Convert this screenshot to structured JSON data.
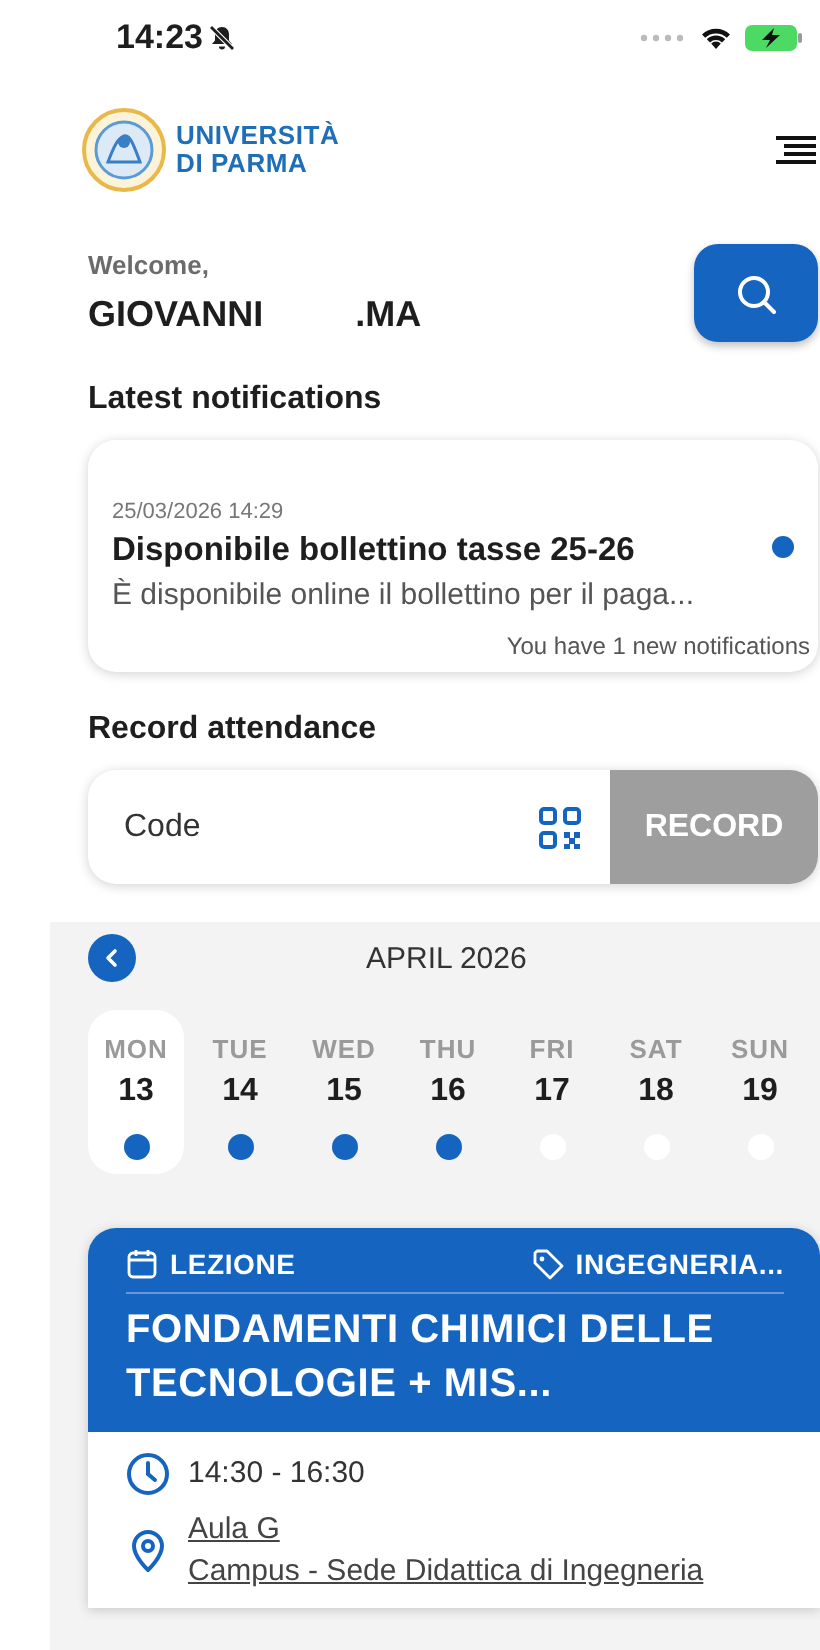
{
  "status_bar": {
    "time": "14:23",
    "muted": true
  },
  "header": {
    "logo_line_1": "UNIVERSITÀ",
    "logo_line_2": "DI PARMA"
  },
  "greeting": {
    "label": "Welcome,",
    "name_first": "GIOVANNI",
    "name_last": ".MA"
  },
  "notifications": {
    "title": "Latest notifications",
    "items": [
      {
        "date": "25/03/2026 14:29",
        "title": "Disponibile bollettino tasse 25-26",
        "body": "È disponibile online il bollettino per il paga...",
        "unread": true
      }
    ],
    "footer": "You have 1 new notifications"
  },
  "attendance": {
    "title": "Record attendance",
    "placeholder": "Code",
    "button": "RECORD",
    "button_disabled": true
  },
  "calendar": {
    "month": "APRIL 2026",
    "days": [
      {
        "weekday": "MON",
        "day": "13",
        "selected": true,
        "has_events": true
      },
      {
        "weekday": "TUE",
        "day": "14",
        "selected": false,
        "has_events": true
      },
      {
        "weekday": "WED",
        "day": "15",
        "selected": false,
        "has_events": true
      },
      {
        "weekday": "THU",
        "day": "16",
        "selected": false,
        "has_events": true
      },
      {
        "weekday": "FRI",
        "day": "17",
        "selected": false,
        "has_events": false
      },
      {
        "weekday": "SAT",
        "day": "18",
        "selected": false,
        "has_events": false
      },
      {
        "weekday": "SUN",
        "day": "19",
        "selected": false,
        "has_events": false
      }
    ]
  },
  "events": [
    {
      "type": "LEZIONE",
      "tag": "INGEGNERIA...",
      "title": "FONDAMENTI CHIMICI DELLE TECNOLOGIE + MIS...",
      "time": "14:30 - 16:30",
      "room": "Aula G",
      "building": "Campus - Sede Didattica di Ingegneria"
    }
  ]
}
